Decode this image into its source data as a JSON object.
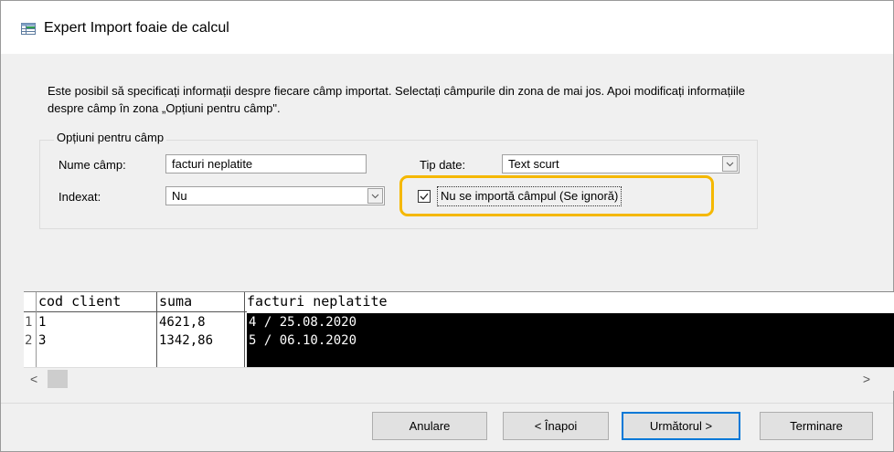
{
  "window": {
    "title": "Expert Import foaie de calcul"
  },
  "description": {
    "line1": "Este posibil să specificați informații despre fiecare câmp importat. Selectați câmpurile din zona de mai jos. Apoi modificați informațiile",
    "line2": "despre câmp în zona „Opțiuni pentru câmp\"."
  },
  "options": {
    "group_label": "Opțiuni pentru câmp",
    "field_name_label": "Nume câmp:",
    "field_name_value": "facturi neplatite",
    "data_type_label": "Tip date:",
    "data_type_value": "Text scurt",
    "indexed_label": "Indexat:",
    "indexed_value": "Nu",
    "skip_field_label": "Nu se importă câmpul (Se ignoră)",
    "skip_field_checked": true
  },
  "grid": {
    "columns": [
      "cod client",
      "suma",
      "facturi neplatite"
    ],
    "rows": [
      {
        "num": "1",
        "cod_client": "1",
        "suma": "4621,8",
        "facturi": "4 / 25.08.2020"
      },
      {
        "num": "2",
        "cod_client": "3",
        "suma": "1342,86",
        "facturi": "5 / 06.10.2020"
      }
    ]
  },
  "scroll": {
    "left_arrow": "<",
    "right_arrow": ">"
  },
  "buttons": {
    "cancel": "Anulare",
    "back": "< Înapoi",
    "next": "Următorul >",
    "finish": "Terminare"
  },
  "colors": {
    "highlight": "#f5b800",
    "default_button_border": "#0078d7"
  }
}
